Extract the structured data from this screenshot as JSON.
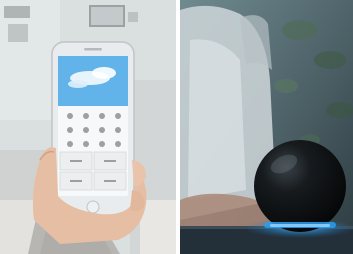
{
  "photos": [
    {
      "id": "left",
      "subject": "hand-holding-smartphone-icon",
      "colors": {
        "wall": "#dcdfe0",
        "phone_body": "#f2f2f2",
        "screen_sky": "#5aaee8",
        "skin": "#e8c3aa",
        "sweater": "#b9b7b4"
      }
    },
    {
      "id": "right",
      "subject": "smart-speaker-orb-icon",
      "colors": {
        "room": "#56696e",
        "orb": "#121416",
        "glow": "#1e8fe0",
        "shirt": "#cfd6da"
      }
    }
  ]
}
